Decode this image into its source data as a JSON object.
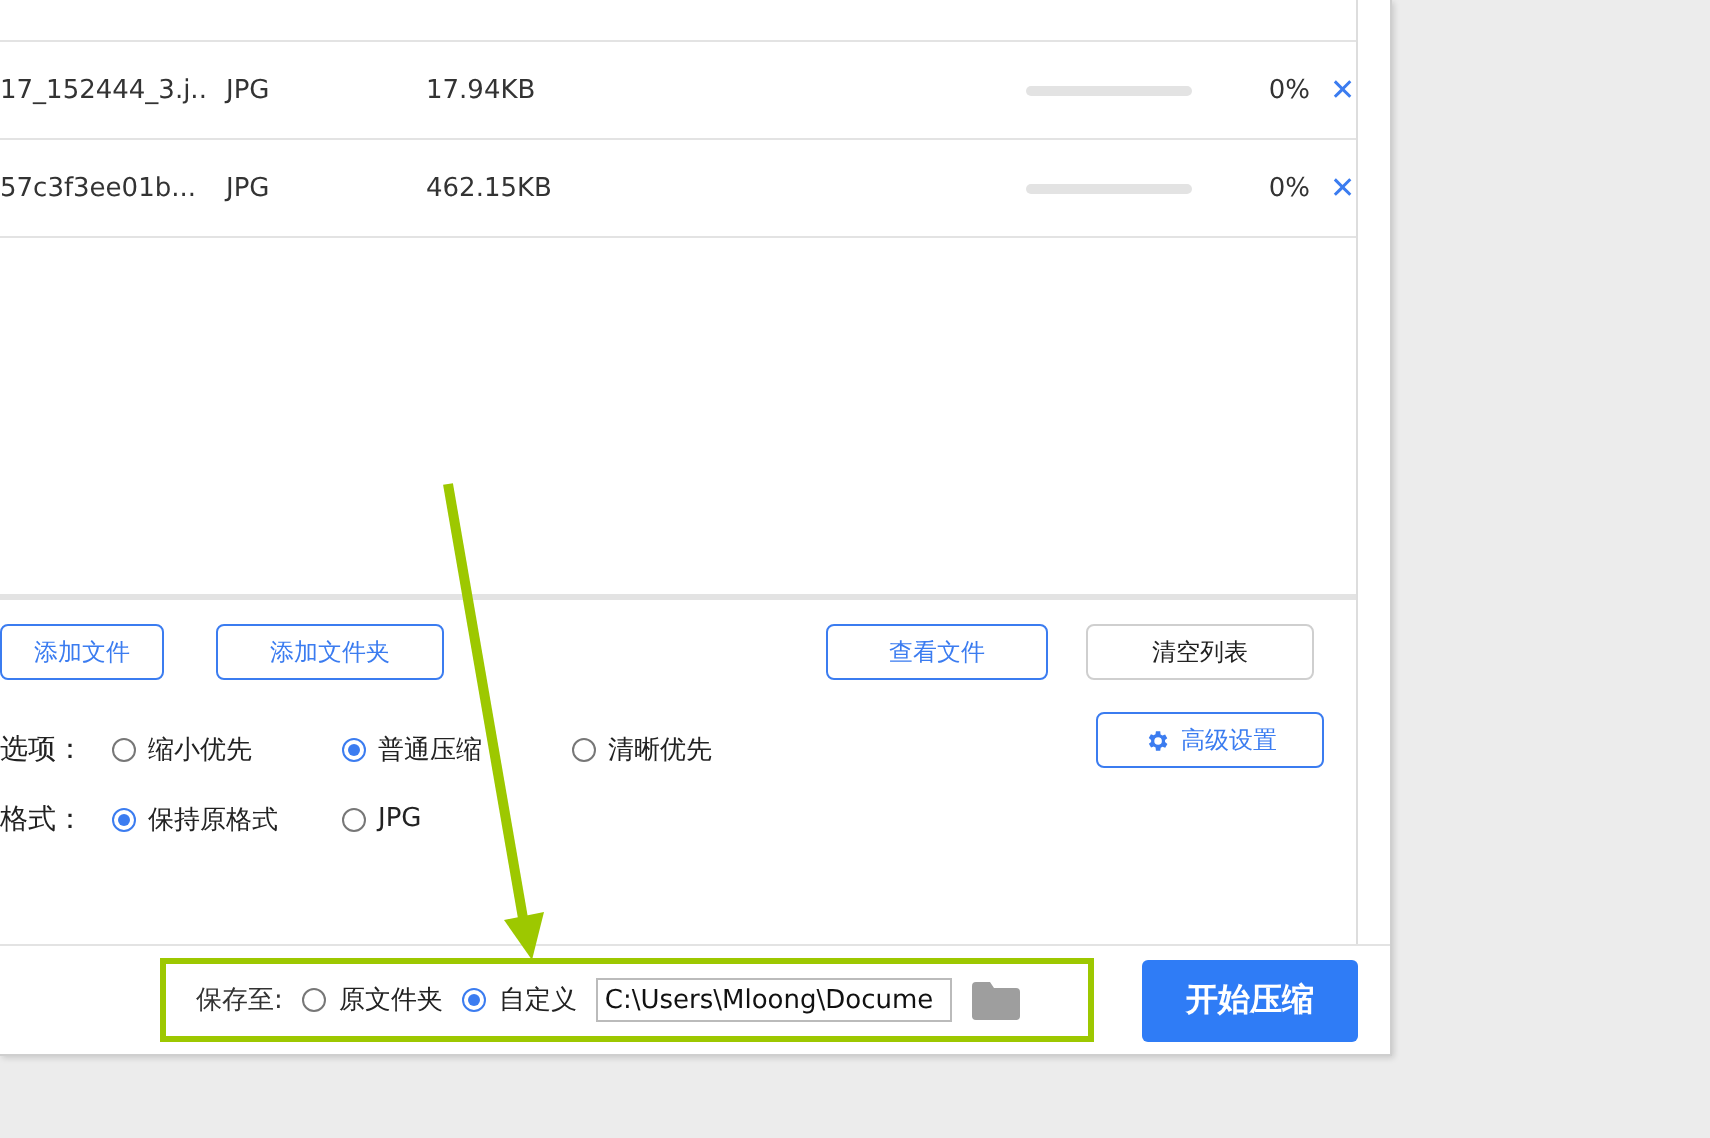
{
  "files": [
    {
      "name": "17_152444_3.j..",
      "type": "JPG",
      "size": "17.94KB",
      "level": 0,
      "percent": "0%",
      "remove": "✕"
    },
    {
      "name": "57c3f3ee01b...",
      "type": "JPG",
      "size": "462.15KB",
      "level": 0,
      "percent": "0%",
      "remove": "✕"
    }
  ],
  "list_buttons": [
    {
      "label": "添加文件",
      "kind": "primary"
    },
    {
      "label": "添加文件夹",
      "kind": "primary"
    },
    {
      "label": "查看文件",
      "kind": "primary"
    },
    {
      "label": "清空列表",
      "kind": "plain"
    }
  ],
  "compress_option": {
    "label": "选项：",
    "options": [
      {
        "label": "缩小优先",
        "selected": false
      },
      {
        "label": "普通压缩",
        "selected": true
      },
      {
        "label": "清晰优先",
        "selected": false
      }
    ]
  },
  "format_option": {
    "label": "格式：",
    "options": [
      {
        "label": "保持原格式",
        "selected": true
      },
      {
        "label": "JPG",
        "selected": false
      }
    ]
  },
  "advanced_button": "高级设置",
  "save": {
    "label": "保存至:",
    "options": [
      {
        "label": "原文件夹",
        "selected": false
      },
      {
        "label": "自定义",
        "selected": true
      }
    ],
    "path": "C:\\Users\\Mloong\\Docume"
  },
  "start_button": "开始压缩"
}
